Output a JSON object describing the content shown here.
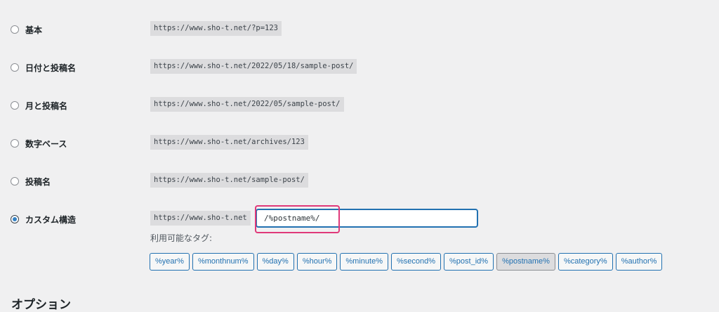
{
  "options": [
    {
      "label": "基本",
      "example": "https://www.sho-t.net/?p=123",
      "checked": false
    },
    {
      "label": "日付と投稿名",
      "example": "https://www.sho-t.net/2022/05/18/sample-post/",
      "checked": false
    },
    {
      "label": "月と投稿名",
      "example": "https://www.sho-t.net/2022/05/sample-post/",
      "checked": false
    },
    {
      "label": "数字ベース",
      "example": "https://www.sho-t.net/archives/123",
      "checked": false
    },
    {
      "label": "投稿名",
      "example": "https://www.sho-t.net/sample-post/",
      "checked": false
    },
    {
      "label": "カスタム構造",
      "example": "https://www.sho-t.net",
      "checked": true
    }
  ],
  "custom_structure": {
    "value": "/%postname%/"
  },
  "tags_heading": "利用可能なタグ:",
  "tags": [
    "%year%",
    "%monthnum%",
    "%day%",
    "%hour%",
    "%minute%",
    "%second%",
    "%post_id%",
    "%postname%",
    "%category%",
    "%author%"
  ],
  "active_tag": "%postname%",
  "section_title": "オプション",
  "colors": {
    "accent": "#2271b1",
    "highlight": "#e0397a",
    "background": "#f0f0f1"
  }
}
